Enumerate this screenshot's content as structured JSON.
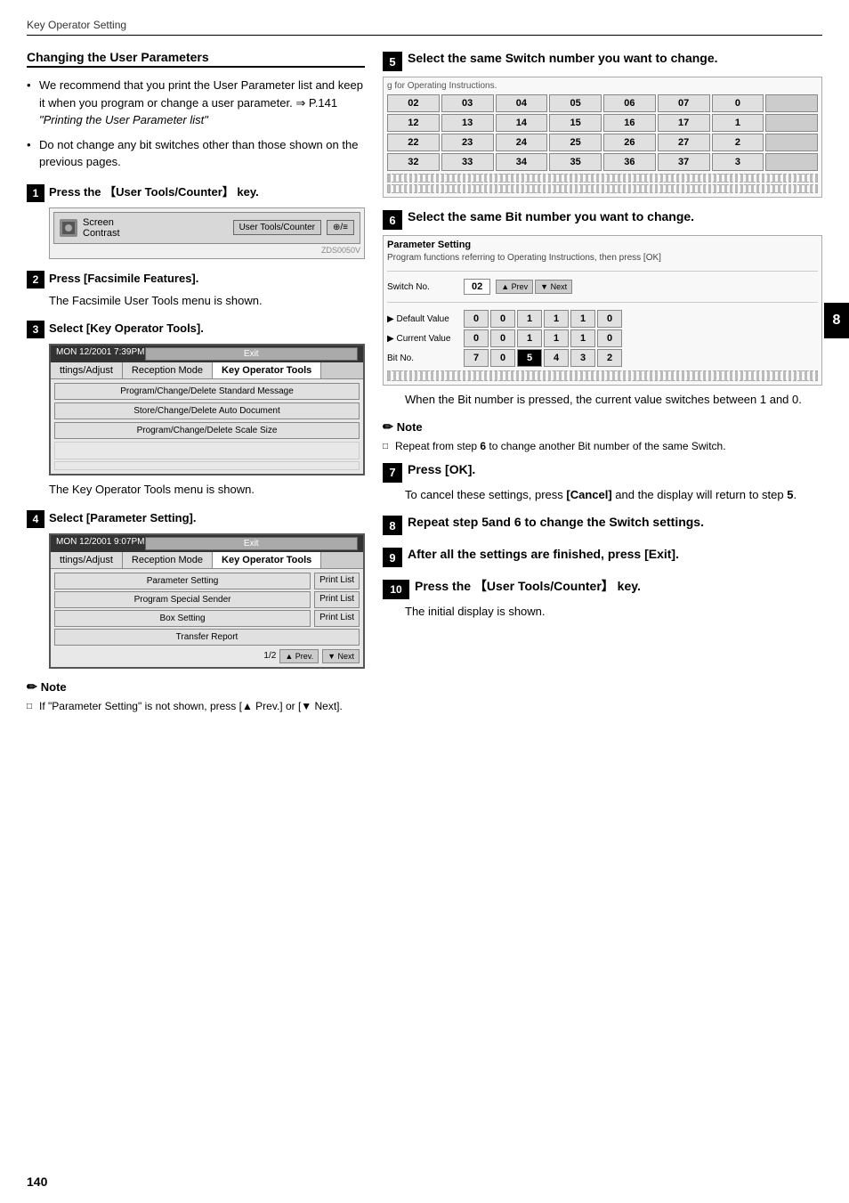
{
  "page": {
    "header": "Key Operator Setting",
    "page_number": "140",
    "chapter_num": "8"
  },
  "section": {
    "title": "Changing the User Parameters",
    "bullets": [
      "We recommend that you print the User Parameter list and keep it when you program or change a user parameter. ⇒ P.141 \"Printing the User Parameter list\"",
      "Do not change any bit switches other than those shown on the previous pages."
    ]
  },
  "steps": {
    "step1": {
      "num": "1",
      "text": "Press the 【User Tools/Counter】 key.",
      "screen": {
        "label": "Screen Contrast",
        "btn_label": "User Tools/Counter",
        "code": "ZDS0050V"
      }
    },
    "step2": {
      "num": "2",
      "text": "Press [Facsimile Features].",
      "body": "The Facsimile User Tools menu is shown."
    },
    "step3": {
      "num": "3",
      "text": "Select [Key Operator Tools].",
      "menu": {
        "header_left": "MON",
        "header_date": "12/2001  7:39PM",
        "exit_btn": "Exit",
        "tabs": [
          "ttings/Adjust",
          "Reception Mode",
          "Key Operator Tools"
        ],
        "items": [
          "Program/Change/Delete Standard Message",
          "Store/Change/Delete Auto Document",
          "Program/Change/Delete Scale Size"
        ]
      },
      "body": "The Key Operator Tools menu is shown."
    },
    "step4": {
      "num": "4",
      "text": "Select [Parameter Setting].",
      "menu2": {
        "header_left": "MON",
        "header_date": "12/2001  9:07PM",
        "exit_btn": "Exit",
        "tabs": [
          "ttings/Adjust",
          "Reception Mode",
          "Key Operator Tools"
        ],
        "items": [
          {
            "label": "Parameter Setting",
            "print": "Print List"
          },
          {
            "label": "Program Special Sender",
            "print": "Print List"
          },
          {
            "label": "Box Setting",
            "print": "Print List"
          },
          {
            "label": "Transfer Report",
            "print": ""
          }
        ],
        "page_info": "1/2",
        "prev_btn": "▲ Prev.",
        "next_btn": "▼ Next"
      }
    },
    "note1": {
      "title": "Note",
      "items": [
        "If \"Parameter Setting\" is not shown, press [▲ Prev.] or [▼ Next]."
      ]
    },
    "step5": {
      "num": "5",
      "text": "Select the same Switch number you want to change.",
      "grid_label": "g for Operating Instructions.",
      "grid": [
        [
          "02",
          "03",
          "04",
          "05",
          "06",
          "07",
          "0"
        ],
        [
          "12",
          "13",
          "14",
          "15",
          "16",
          "17",
          "1"
        ],
        [
          "22",
          "23",
          "24",
          "25",
          "26",
          "27",
          "2"
        ],
        [
          "32",
          "33",
          "34",
          "35",
          "36",
          "37",
          "3"
        ]
      ],
      "grid_last_col": [
        "0",
        "1",
        "2",
        "3"
      ]
    },
    "step6": {
      "num": "6",
      "text": "Select the same Bit number you want to change.",
      "param": {
        "title": "Parameter Setting",
        "subtitle": "Program functions referring to Operating Instructions, then press [OK]",
        "switch_label": "Switch No.",
        "switch_value": "02",
        "prev_btn": "▲ Prev",
        "next_btn": "▼ Next",
        "default_label": "▶ Default Value",
        "default_values": [
          "0",
          "0",
          "1",
          "1",
          "1",
          "0"
        ],
        "current_label": "▶ Current Value",
        "current_values": [
          "0",
          "0",
          "1",
          "1",
          "1",
          "0"
        ],
        "bit_label": "Bit No.",
        "bit_nums": [
          "7",
          "0",
          "5",
          "4",
          "3",
          "2"
        ],
        "selected_bit": "5"
      },
      "body": "When the Bit number is pressed, the current value switches between 1 and 0."
    },
    "note2": {
      "title": "Note",
      "items": [
        "Repeat from step 6 to change another Bit number of the same Switch."
      ]
    },
    "step7": {
      "num": "7",
      "text": "Press [OK].",
      "body": "To cancel these settings, press [Cancel] and the display will return to step 5."
    },
    "step8": {
      "num": "8",
      "text": "Repeat step 5and 6 to change the Switch settings."
    },
    "step9": {
      "num": "9",
      "text": "After all the settings are finished, press [Exit]."
    },
    "step10": {
      "num": "10",
      "text": "Press the 【User Tools/Counter】 key.",
      "body": "The initial display is shown."
    }
  }
}
